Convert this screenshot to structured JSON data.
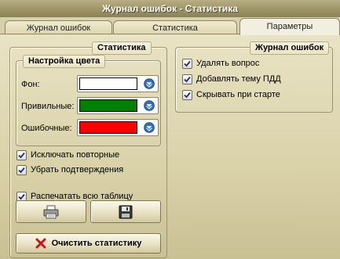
{
  "window": {
    "title": "Журнал ошибок - Статистика"
  },
  "tabs": [
    {
      "label": "Журнал ошибок"
    },
    {
      "label": "Статистика"
    },
    {
      "label": "Параметры"
    }
  ],
  "statistics": {
    "title": "Статистика",
    "color_settings": {
      "title": "Настройка цвета",
      "rows": [
        {
          "label": "Фон:",
          "color": "#ffffff"
        },
        {
          "label": "Привильные:",
          "color": "#008000"
        },
        {
          "label": "Ошибочные:",
          "color": "#ff0000"
        }
      ]
    },
    "options": [
      {
        "label": "Исключать повторные",
        "checked": true
      },
      {
        "label": "Убрать подтверждения",
        "checked": true
      },
      {
        "label": "Распечатать всю таблицу",
        "checked": true
      }
    ],
    "print_button": {
      "icon": "printer-icon"
    },
    "save_button": {
      "icon": "floppy-disk-icon"
    },
    "clear_button": {
      "label": "Очистить статистику",
      "icon": "red-x-icon"
    }
  },
  "error_log": {
    "title": "Журнал ошибок",
    "options": [
      {
        "label": "Удалять вопрос",
        "checked": true
      },
      {
        "label": "Добавлять тему ПДД",
        "checked": true
      },
      {
        "label": "Скрывать при старте",
        "checked": true
      }
    ]
  }
}
